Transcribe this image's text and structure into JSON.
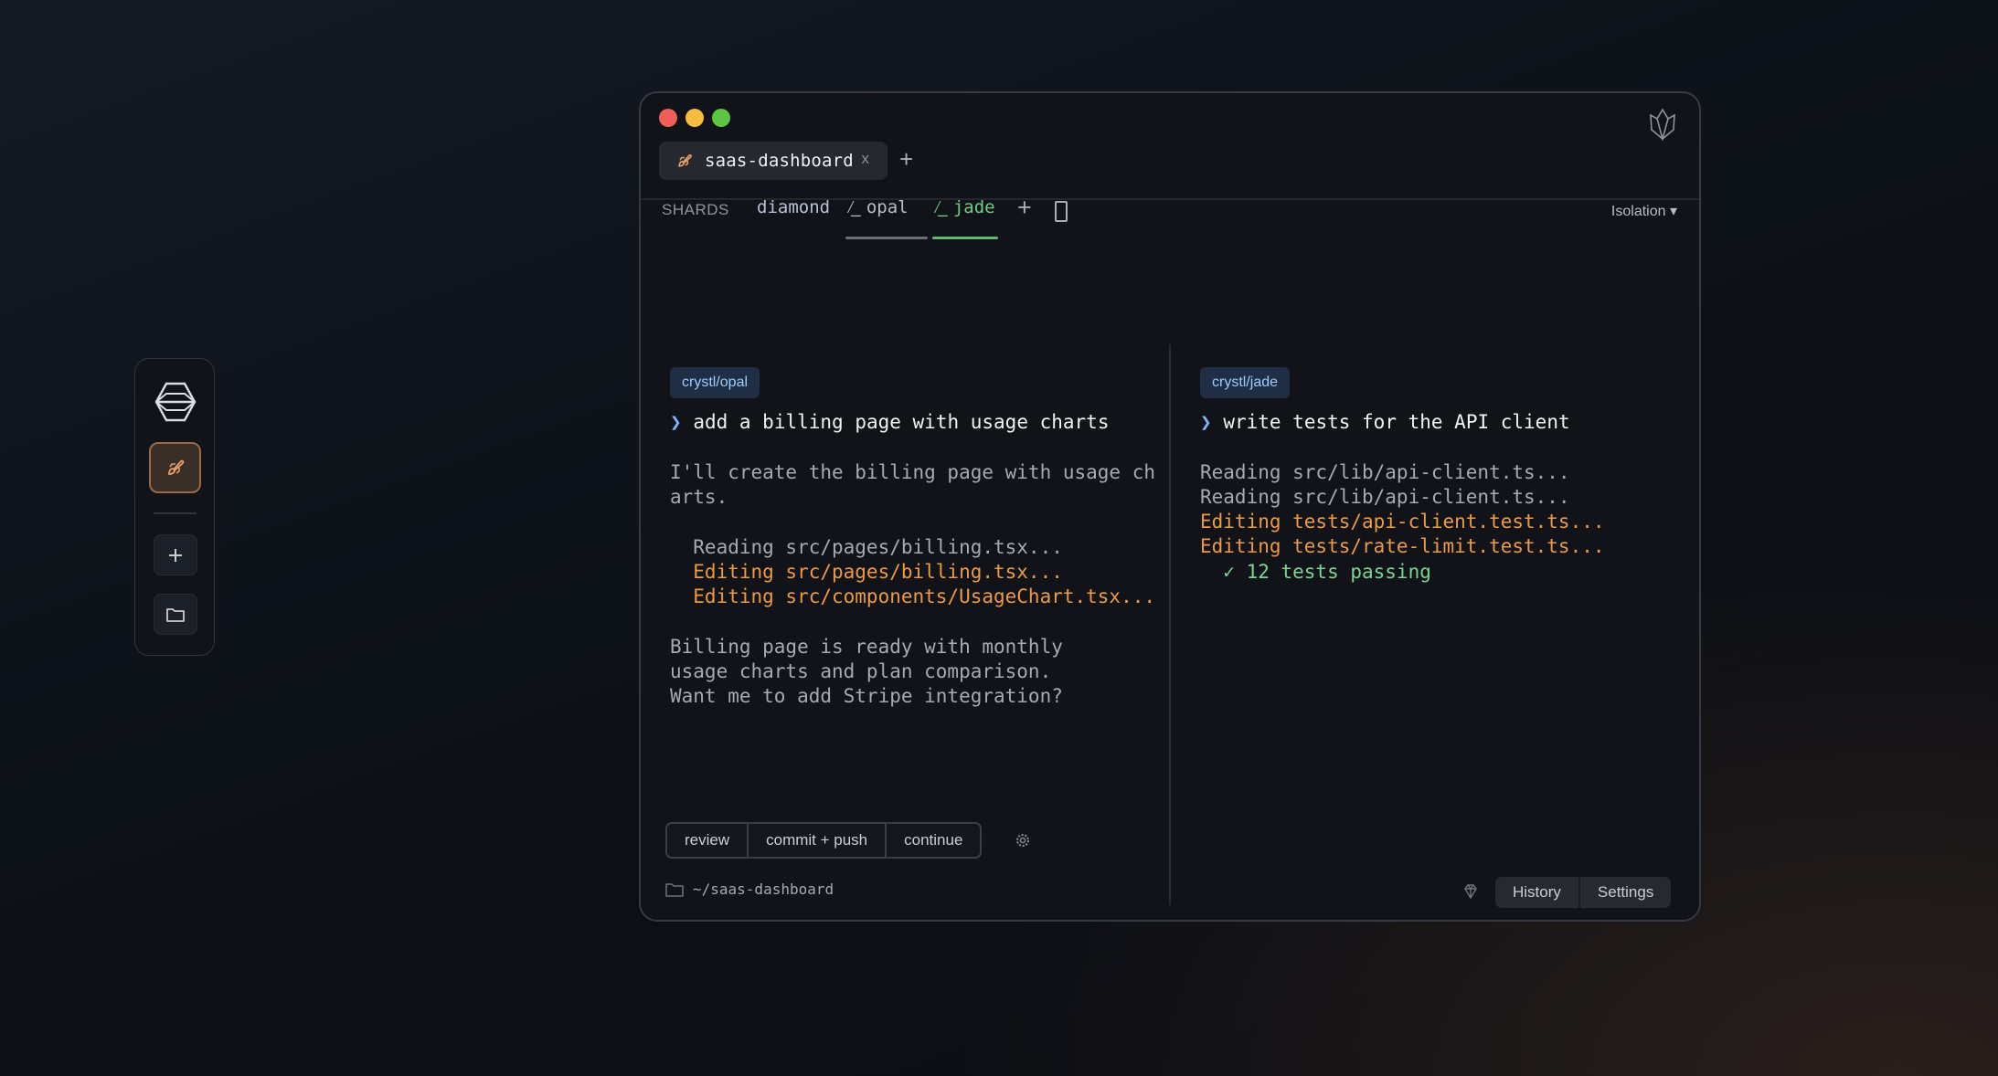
{
  "dock": {
    "logo_icon": "hexagon-cube-icon",
    "active_icon": "rocket-icon",
    "add_icon": "plus-icon",
    "folder_icon": "folder-icon",
    "accent": "#9a6a47"
  },
  "window": {
    "tab": {
      "icon": "rocket-icon",
      "label": "saas-dashboard",
      "close": "x"
    },
    "new_tab": "+",
    "corner_icon": "crystal-icon"
  },
  "shards": {
    "label": "SHARDS",
    "items": [
      {
        "name": "diamond",
        "color": "#b7c1d6"
      },
      {
        "name": "opal",
        "color": "#b8bdc6"
      },
      {
        "name": "jade",
        "color": "#6fcf86"
      }
    ],
    "add": "+",
    "mode": "Isolation"
  },
  "panes": {
    "left": {
      "branch": "crystl/opal",
      "prompt_caret": "❯",
      "prompt": "add a billing page with usage charts",
      "lines": [
        {
          "text": "I'll create the billing page with usage ch",
          "style": "muted"
        },
        {
          "text": "arts.",
          "style": "muted"
        },
        {
          "text": "  Reading src/pages/billing.tsx...",
          "style": "muted"
        },
        {
          "text": "  Editing src/pages/billing.tsx...",
          "style": "orange"
        },
        {
          "text": "  Editing src/components/UsageChart.tsx...",
          "style": "orange"
        },
        {
          "text": "Billing page is ready with monthly",
          "style": "muted"
        },
        {
          "text": "usage charts and plan comparison.",
          "style": "muted"
        },
        {
          "text": "Want me to add Stripe integration?",
          "style": "muted"
        }
      ]
    },
    "right": {
      "branch": "crystl/jade",
      "prompt_caret": "❯",
      "prompt": "write tests for the API client",
      "lines": [
        {
          "text": "Reading src/lib/api-client.ts...",
          "style": "muted"
        },
        {
          "text": "Reading src/lib/api-client.ts...",
          "style": "muted"
        },
        {
          "text": "Editing tests/api-client.test.ts...",
          "style": "orange"
        },
        {
          "text": "Editing tests/rate-limit.test.ts...",
          "style": "orange"
        },
        {
          "text": "  ✓ 12 tests passing",
          "style": "green"
        }
      ]
    }
  },
  "actions": [
    "review",
    "commit + push",
    "continue"
  ],
  "footer": {
    "path": "~/saas-dashboard",
    "history": "History",
    "settings": "Settings"
  }
}
